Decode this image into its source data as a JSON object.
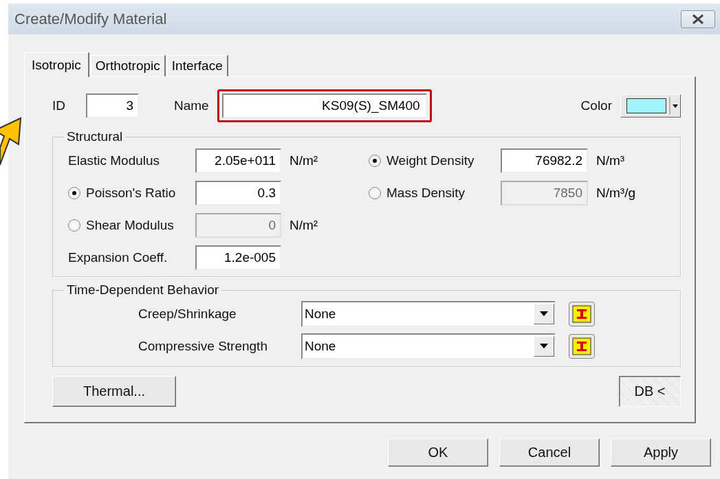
{
  "window": {
    "title": "Create/Modify Material"
  },
  "tabs": [
    {
      "label": "Isotropic",
      "selected": true
    },
    {
      "label": "Orthotropic",
      "selected": false
    },
    {
      "label": "Interface",
      "selected": false
    }
  ],
  "id": {
    "label": "ID",
    "value": "3"
  },
  "name": {
    "label": "Name",
    "value": "KS09(S)_SM400",
    "highlighted": true
  },
  "color": {
    "label": "Color",
    "color": "#a0f4fa"
  },
  "structural": {
    "title": "Structural",
    "rows": [
      {
        "left": {
          "kind": "field",
          "label": "Elastic Modulus",
          "value": "2.05e+011",
          "unit": "N/m²",
          "disabled": false
        },
        "right": {
          "kind": "radio",
          "label": "Weight Density",
          "selected": true,
          "value": "76982.2",
          "unit": "N/m³",
          "disabled": false
        }
      },
      {
        "left": {
          "kind": "radio",
          "label": "Poisson's Ratio",
          "selected": true,
          "value": "0.3",
          "disabled": false
        },
        "right": {
          "kind": "radio",
          "label": "Mass Density",
          "selected": false,
          "value": "7850",
          "unit": "N/m³/g",
          "disabled": true
        }
      },
      {
        "left": {
          "kind": "radio",
          "label": "Shear Modulus",
          "selected": false,
          "value": "0",
          "unit": "N/m²",
          "disabled": true
        }
      },
      {
        "left": {
          "kind": "field",
          "label": "Expansion Coeff.",
          "value": "1.2e-005",
          "disabled": false
        }
      }
    ]
  },
  "time_dependent": {
    "title": "Time-Dependent Behavior",
    "rows": [
      {
        "label": "Creep/Shrinkage",
        "value": "None"
      },
      {
        "label": "Compressive Strength",
        "value": "None"
      }
    ]
  },
  "thermal_button": "Thermal...",
  "db_button": "DB <",
  "footer_buttons": [
    "OK",
    "Cancel",
    "Apply"
  ]
}
